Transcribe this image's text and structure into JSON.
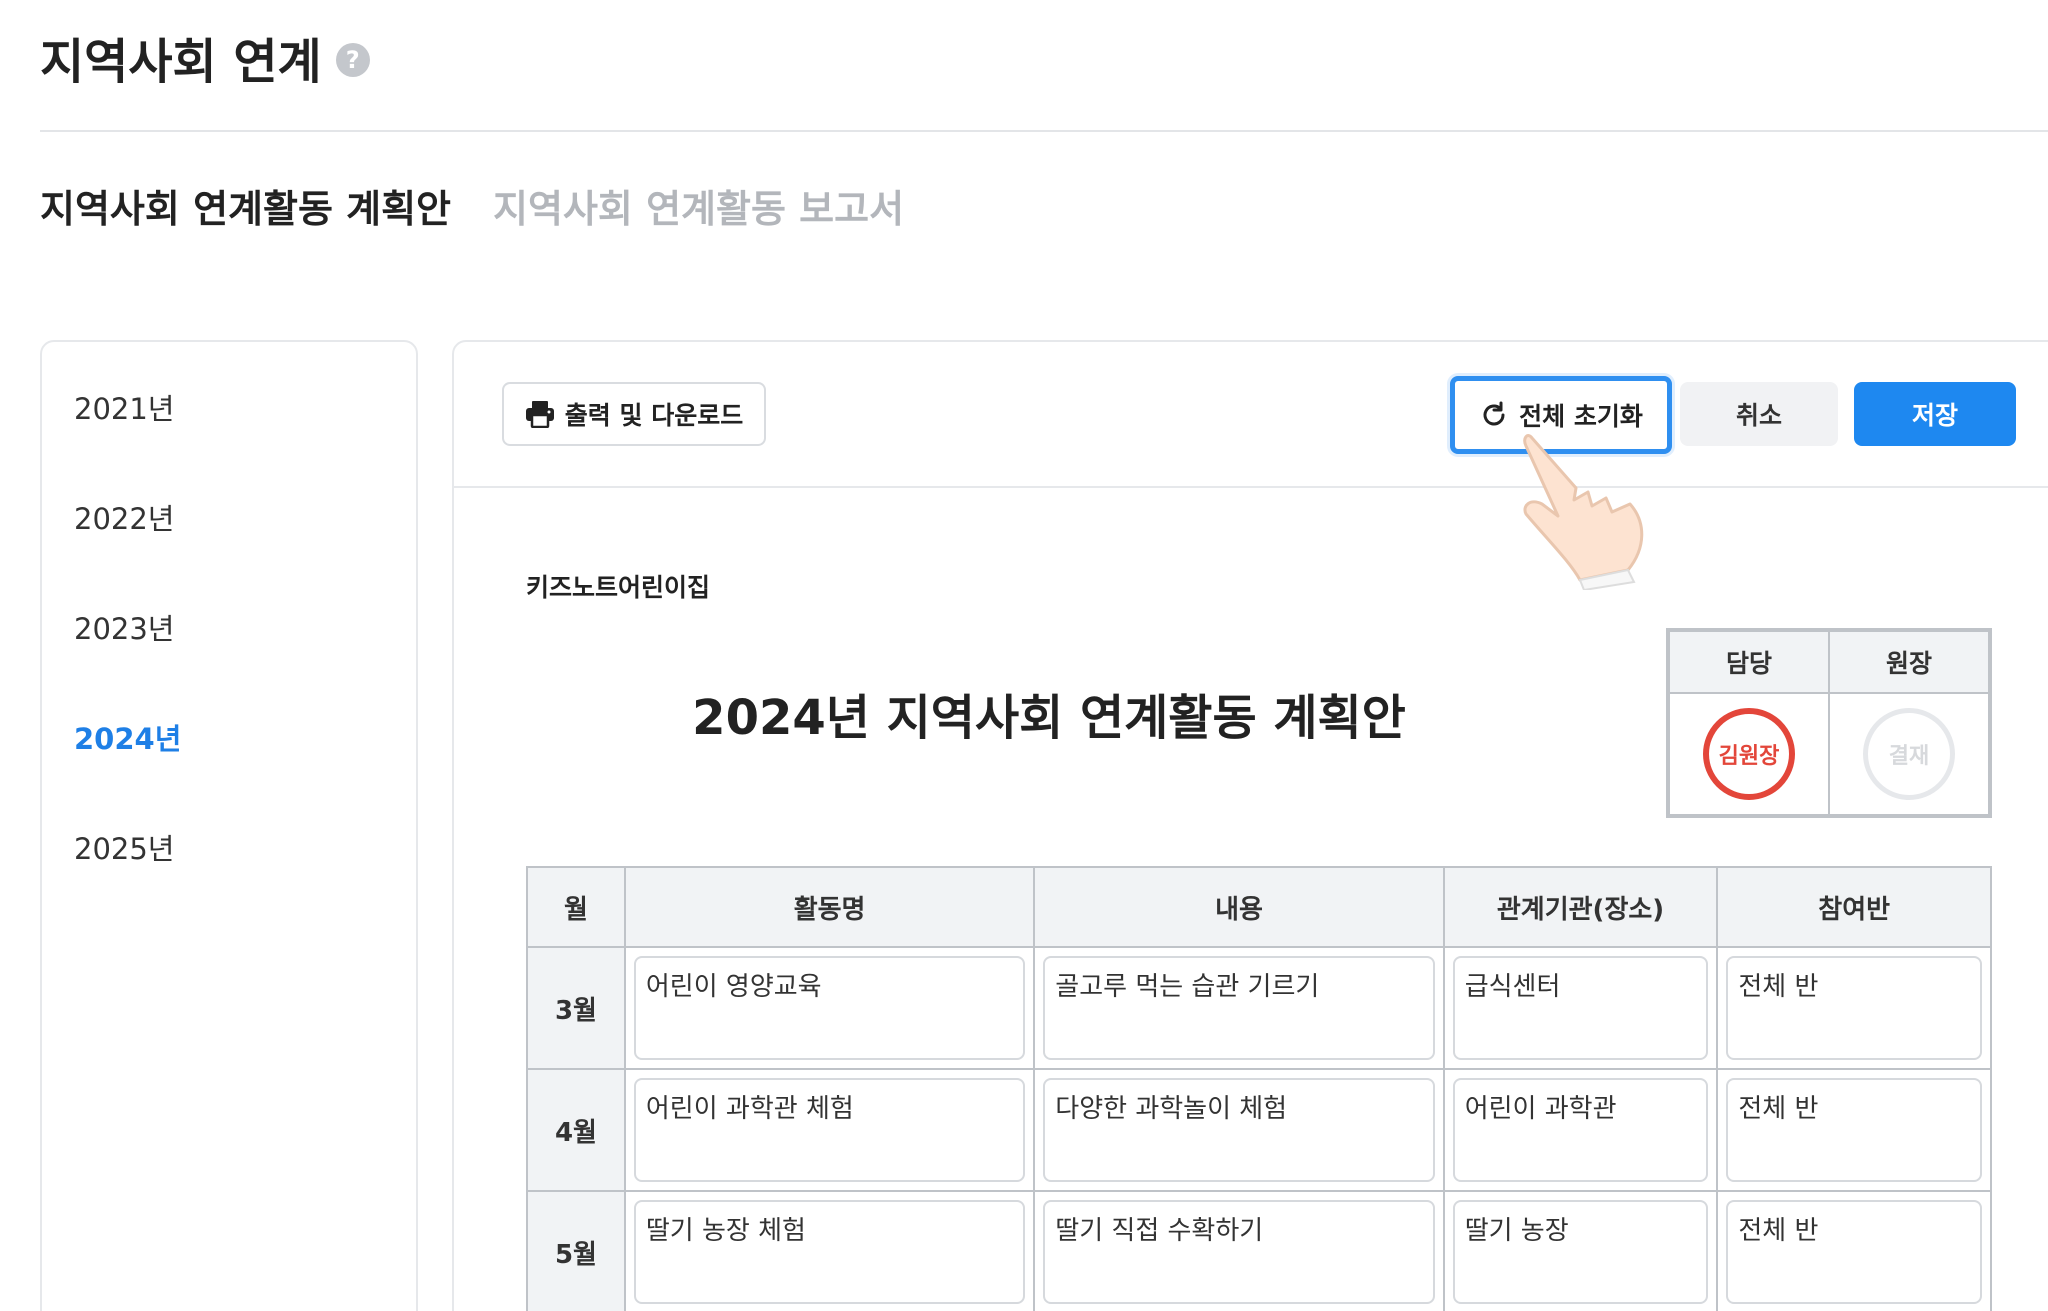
{
  "header": {
    "title": "지역사회 연계"
  },
  "tabs": [
    {
      "label": "지역사회 연계활동 계획안",
      "active": true
    },
    {
      "label": "지역사회 연계활동 보고서",
      "active": false
    }
  ],
  "sidebar": {
    "years": [
      "2021년",
      "2022년",
      "2023년",
      "2024년",
      "2025년"
    ],
    "selected": "2024년"
  },
  "toolbar": {
    "print_label": "출력 및 다운로드",
    "reset_label": "전체 초기화",
    "cancel_label": "취소",
    "save_label": "저장"
  },
  "document": {
    "org_name": "키즈노트어린이집",
    "title": "2024년 지역사회 연계활동 계획안",
    "approval": {
      "headers": [
        "담당",
        "원장"
      ],
      "stamps": [
        "김원장",
        "결재"
      ]
    },
    "table": {
      "headers": [
        "월",
        "활동명",
        "내용",
        "관계기관(장소)",
        "참여반"
      ],
      "rows": [
        {
          "month": "3월",
          "activity": "어린이 영양교육",
          "content": "골고루 먹는 습관 기르기",
          "org": "급식센터",
          "class": "전체 반"
        },
        {
          "month": "4월",
          "activity": "어린이 과학관 체험",
          "content": "다양한 과학놀이 체험",
          "org": "어린이 과학관",
          "class": "전체 반"
        },
        {
          "month": "5월",
          "activity": "딸기 농장 체험",
          "content": "딸기 직접 수확하기",
          "org": "딸기 농장",
          "class": "전체 반"
        }
      ]
    }
  },
  "colors": {
    "accent": "#1e88f0",
    "selected_year": "#1e7fe6",
    "stamp_red": "#e3463a"
  }
}
